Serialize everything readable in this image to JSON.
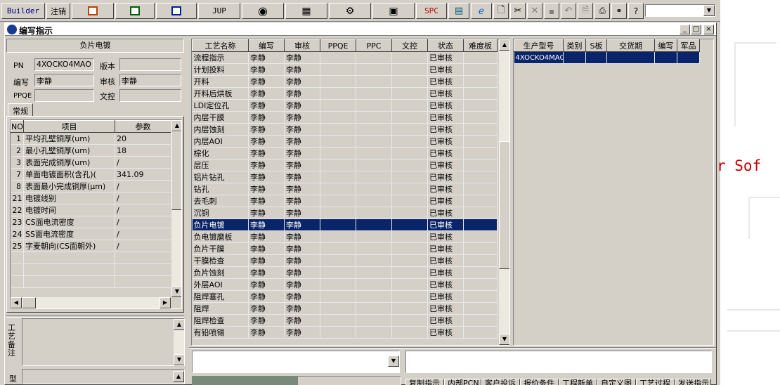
{
  "toolbar": {
    "builder": "Builder",
    "logout": "注销",
    "jup": "JUP",
    "spc": "SPC",
    "icons": [
      "presentation-icon",
      "excel-icon",
      "word-icon",
      "jup-text",
      "eye-icon",
      "database-icon",
      "tools-icon",
      "computer-icon",
      "spc-text",
      "chart-icon",
      "ie-icon",
      "new-icon",
      "cut-icon",
      "close-x-icon",
      "save-icon",
      "undo-icon",
      "preview-icon",
      "print-icon",
      "binoculars-icon",
      "help-icon"
    ]
  },
  "desktop": {
    "text": "r Sof"
  },
  "window": {
    "title": "编写指示",
    "minimize": "_",
    "maximize": "□",
    "close": "×"
  },
  "left": {
    "header": "负片电镀",
    "pn_label": "PN",
    "pn_value": "4XOCKO4MAO",
    "version_label": "版本",
    "version_value": "",
    "author_label": "编写",
    "author_value": "李静",
    "review_label": "审核",
    "review_value": "李静",
    "ppqe_label": "PPQE",
    "ppqe_value": "",
    "doc_label": "文控",
    "doc_value": "",
    "tab_general": "常规",
    "param_headers": [
      "NO",
      "项目",
      "参数"
    ],
    "params": [
      {
        "no": "1",
        "item": "平均孔壁铜厚(um)",
        "value": "20"
      },
      {
        "no": "2",
        "item": "最小孔壁铜厚(um)",
        "value": "18"
      },
      {
        "no": "3",
        "item": "表面完成铜厚(um)",
        "value": "/"
      },
      {
        "no": "7",
        "item": "单面电镀面积(含孔)(",
        "value": "341.09"
      },
      {
        "no": "8",
        "item": "表面最小完成铜厚(μm)",
        "value": "/"
      },
      {
        "no": "21",
        "item": "电镀线别",
        "value": "/"
      },
      {
        "no": "22",
        "item": "电镀时间",
        "value": "/"
      },
      {
        "no": "23",
        "item": "CS面电流密度",
        "value": "/"
      },
      {
        "no": "24",
        "item": "SS面电流密度",
        "value": "/"
      },
      {
        "no": "25",
        "item": "字麦朝向(CS面朝外)",
        "value": "/"
      }
    ],
    "process_note_label": "工艺备注",
    "type_label": "型"
  },
  "process": {
    "headers": [
      "工艺名称",
      "编写",
      "审核",
      "PPQE",
      "PPC",
      "文控",
      "状态",
      "难度板"
    ],
    "selected_index": 14,
    "rows": [
      {
        "name": "流程指示",
        "author": "李静",
        "review": "李静",
        "status": "已审核"
      },
      {
        "name": "计划投料",
        "author": "李静",
        "review": "李静",
        "status": "已审核"
      },
      {
        "name": "开料",
        "author": "李静",
        "review": "李静",
        "status": "已审核"
      },
      {
        "name": "开料后烘板",
        "author": "李静",
        "review": "李静",
        "status": "已审核"
      },
      {
        "name": "LDI定位孔",
        "author": "李静",
        "review": "李静",
        "status": "已审核"
      },
      {
        "name": "内层干膜",
        "author": "李静",
        "review": "李静",
        "status": "已审核"
      },
      {
        "name": "内层蚀刻",
        "author": "李静",
        "review": "李静",
        "status": "已审核"
      },
      {
        "name": "内层AOI",
        "author": "李静",
        "review": "李静",
        "status": "已审核"
      },
      {
        "name": "棕化",
        "author": "李静",
        "review": "李静",
        "status": "已审核"
      },
      {
        "name": "层压",
        "author": "李静",
        "review": "李静",
        "status": "已审核"
      },
      {
        "name": "铝片钻孔",
        "author": "李静",
        "review": "李静",
        "status": "已审核"
      },
      {
        "name": "钻孔",
        "author": "李静",
        "review": "李静",
        "status": "已审核"
      },
      {
        "name": "去毛刺",
        "author": "李静",
        "review": "李静",
        "status": "已审核"
      },
      {
        "name": "沉铜",
        "author": "李静",
        "review": "李静",
        "status": "已审核"
      },
      {
        "name": "负片电镀",
        "author": "李静",
        "review": "李静",
        "status": "已审核"
      },
      {
        "name": "负电镀磨板",
        "author": "李静",
        "review": "李静",
        "status": "已审核"
      },
      {
        "name": "负片干膜",
        "author": "李静",
        "review": "李静",
        "status": "已审核"
      },
      {
        "name": "干膜检查",
        "author": "李静",
        "review": "李静",
        "status": "已审核"
      },
      {
        "name": "负片蚀刻",
        "author": "李静",
        "review": "李静",
        "status": "已审核"
      },
      {
        "name": "外层AOI",
        "author": "李静",
        "review": "李静",
        "status": "已审核"
      },
      {
        "name": "阻焊塞孔",
        "author": "李静",
        "review": "李静",
        "status": "已审核"
      },
      {
        "name": "阻焊",
        "author": "李静",
        "review": "李静",
        "status": "已审核"
      },
      {
        "name": "阻焊检查",
        "author": "李静",
        "review": "李静",
        "status": "已审核"
      },
      {
        "name": "有铅喷锡",
        "author": "李静",
        "review": "李静",
        "status": "已审核"
      }
    ]
  },
  "product": {
    "headers": [
      "生产型号",
      "类别",
      "S板",
      "交货期",
      "编写",
      "军品"
    ],
    "rows": [
      {
        "model": "4XOCKO4MAO"
      }
    ]
  },
  "bottom_tabs": [
    "复制指示",
    "内部PCN",
    "客户投诉",
    "报价条件",
    "工程新单",
    "自定义图",
    "工艺过程",
    "发送指示"
  ]
}
